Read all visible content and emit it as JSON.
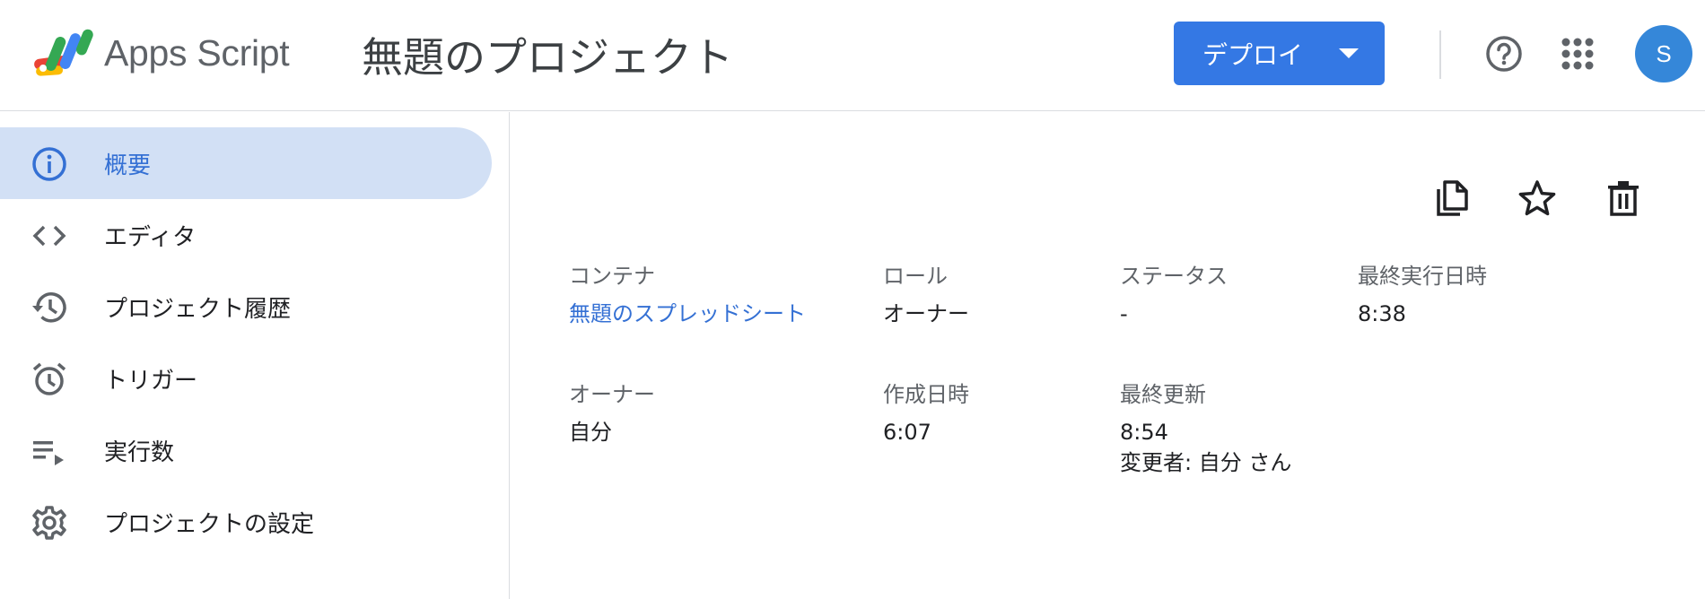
{
  "header": {
    "product_name": "Apps Script",
    "project_title": "無題のプロジェクト",
    "deploy_label": "デプロイ",
    "avatar_letter": "S",
    "icons": [
      "apps-script-logo",
      "help-icon",
      "apps-grid-icon",
      "chevron-down-icon"
    ]
  },
  "sidebar": {
    "items": [
      {
        "label": "概要",
        "icon": "info-icon",
        "active": true
      },
      {
        "label": "エディタ",
        "icon": "code-icon",
        "active": false
      },
      {
        "label": "プロジェクト履歴",
        "icon": "history-icon",
        "active": false
      },
      {
        "label": "トリガー",
        "icon": "alarm-icon",
        "active": false
      },
      {
        "label": "実行数",
        "icon": "playlist-play-icon",
        "active": false
      },
      {
        "label": "プロジェクトの設定",
        "icon": "gear-icon",
        "active": false
      }
    ]
  },
  "main": {
    "actions": [
      "copy-icon",
      "star-icon",
      "trash-icon"
    ],
    "fields": {
      "container": {
        "label": "コンテナ",
        "value": "無題のスプレッドシート"
      },
      "role": {
        "label": "ロール",
        "value": "オーナー"
      },
      "status": {
        "label": "ステータス",
        "value": "-"
      },
      "last_run": {
        "label": "最終実行日時",
        "value": "8:38"
      },
      "owner": {
        "label": "オーナー",
        "value": "自分"
      },
      "created": {
        "label": "作成日時",
        "value": "6:07"
      },
      "updated": {
        "label": "最終更新",
        "value": "8:54",
        "by": "変更者: 自分 さん"
      }
    }
  },
  "colors": {
    "accent": "#3478e4",
    "active_nav_bg": "#d2e0f5",
    "active_nav_text": "#3470d4",
    "avatar": "#3587d9"
  }
}
